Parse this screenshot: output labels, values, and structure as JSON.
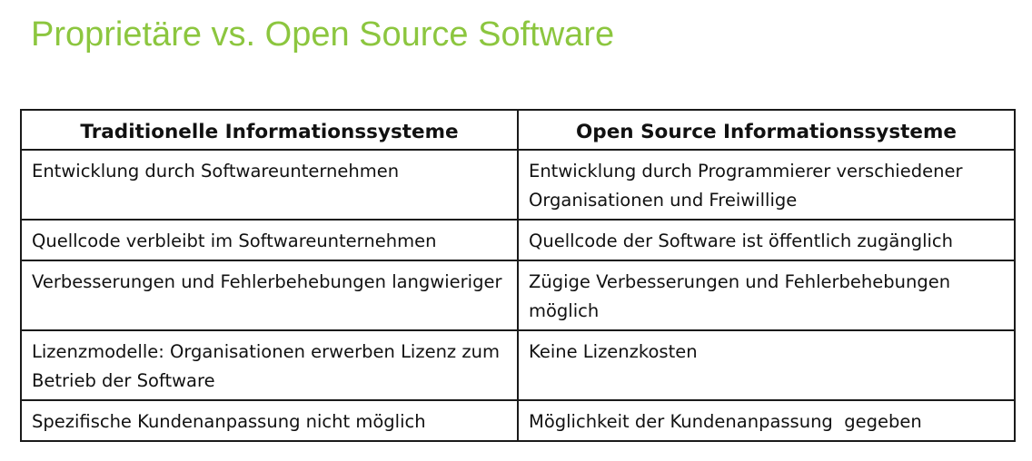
{
  "slide": {
    "title": "Proprietäre vs. Open Source Software"
  },
  "table": {
    "headers": [
      "Traditionelle Informationssysteme",
      "Open Source Informationssysteme"
    ],
    "rows": [
      [
        "Entwicklung durch Softwareunternehmen",
        "Entwicklung durch Programmierer verschiedener Organisationen und Freiwillige"
      ],
      [
        "Quellcode verbleibt im Softwareunternehmen",
        "Quellcode der Software ist öffentlich zugänglich"
      ],
      [
        "Verbesserungen und Fehlerbehebungen langwieriger",
        "Zügige Verbesserungen und Fehlerbehebungen möglich"
      ],
      [
        "Lizenzmodelle: Organisationen erwerben Lizenz zum Betrieb der Software",
        "Keine Lizenzkosten"
      ],
      [
        "Spezifische Kundenanpassung nicht möglich",
        "Möglichkeit der Kundenanpassung  gegeben"
      ]
    ]
  },
  "colors": {
    "title": "#8cc63f",
    "text": "#111111",
    "border": "#1a1a1a"
  }
}
